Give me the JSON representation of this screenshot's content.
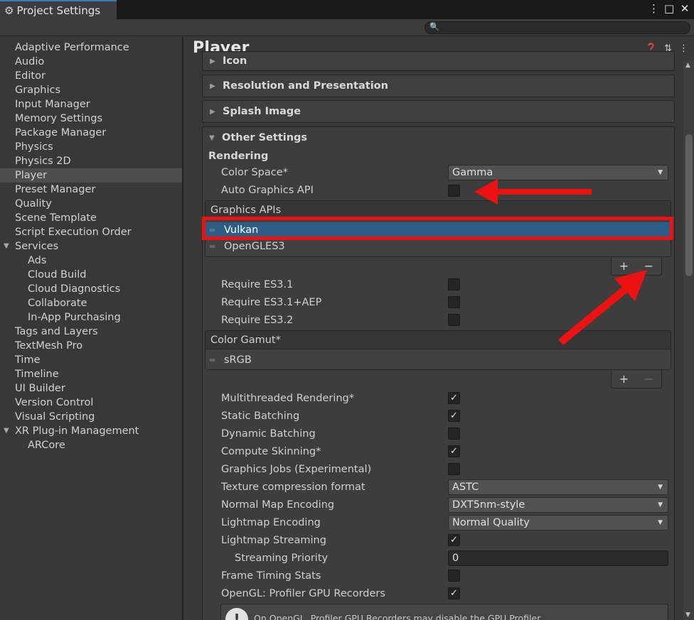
{
  "window": {
    "tab_title": "Project Settings",
    "controls": [
      "⋮",
      "□",
      "✕"
    ]
  },
  "search": {
    "placeholder": "",
    "icon": "search-icon"
  },
  "sidebar": {
    "items": [
      {
        "label": "Adaptive Performance",
        "indent": 0
      },
      {
        "label": "Audio",
        "indent": 0
      },
      {
        "label": "Editor",
        "indent": 0
      },
      {
        "label": "Graphics",
        "indent": 0
      },
      {
        "label": "Input Manager",
        "indent": 0
      },
      {
        "label": "Memory Settings",
        "indent": 0
      },
      {
        "label": "Package Manager",
        "indent": 0
      },
      {
        "label": "Physics",
        "indent": 0
      },
      {
        "label": "Physics 2D",
        "indent": 0
      },
      {
        "label": "Player",
        "indent": 0,
        "selected": true
      },
      {
        "label": "Preset Manager",
        "indent": 0
      },
      {
        "label": "Quality",
        "indent": 0
      },
      {
        "label": "Scene Template",
        "indent": 0
      },
      {
        "label": "Script Execution Order",
        "indent": 0
      },
      {
        "label": "Services",
        "indent": 0,
        "expanded": true
      },
      {
        "label": "Ads",
        "indent": 1
      },
      {
        "label": "Cloud Build",
        "indent": 1
      },
      {
        "label": "Cloud Diagnostics",
        "indent": 1
      },
      {
        "label": "Collaborate",
        "indent": 1
      },
      {
        "label": "In-App Purchasing",
        "indent": 1
      },
      {
        "label": "Tags and Layers",
        "indent": 0
      },
      {
        "label": "TextMesh Pro",
        "indent": 0
      },
      {
        "label": "Time",
        "indent": 0
      },
      {
        "label": "Timeline",
        "indent": 0
      },
      {
        "label": "UI Builder",
        "indent": 0
      },
      {
        "label": "Version Control",
        "indent": 0
      },
      {
        "label": "Visual Scripting",
        "indent": 0
      },
      {
        "label": "XR Plug-in Management",
        "indent": 0,
        "expanded": true
      },
      {
        "label": "ARCore",
        "indent": 1
      }
    ]
  },
  "main": {
    "title": "Player",
    "sections": {
      "icon": "Icon",
      "resolution": "Resolution and Presentation",
      "splash": "Splash Image",
      "other": "Other Settings"
    },
    "rendering": {
      "group_label": "Rendering",
      "color_space_label": "Color Space*",
      "color_space_value": "Gamma",
      "auto_graphics_label": "Auto Graphics API",
      "auto_graphics_checked": false,
      "graphics_apis": {
        "header": "Graphics APIs",
        "items": [
          "Vulkan",
          "OpenGLES3"
        ],
        "selected": "Vulkan"
      },
      "require_es31_label": "Require ES3.1",
      "require_es31_aep_label": "Require ES3.1+AEP",
      "require_es32_label": "Require ES3.2",
      "color_gamut": {
        "header": "Color Gamut*",
        "items": [
          "sRGB"
        ]
      },
      "multithreaded_label": "Multithreaded Rendering*",
      "static_batching_label": "Static Batching",
      "dynamic_batching_label": "Dynamic Batching",
      "compute_skinning_label": "Compute Skinning*",
      "graphics_jobs_label": "Graphics Jobs (Experimental)",
      "texture_compression_label": "Texture compression format",
      "texture_compression_value": "ASTC",
      "normal_map_label": "Normal Map Encoding",
      "normal_map_value": "DXT5nm-style",
      "lightmap_encoding_label": "Lightmap Encoding",
      "lightmap_encoding_value": "Normal Quality",
      "lightmap_streaming_label": "Lightmap Streaming",
      "streaming_priority_label": "Streaming Priority",
      "streaming_priority_value": "0",
      "frame_timing_label": "Frame Timing Stats",
      "opengl_profiler_label": "OpenGL: Profiler GPU Recorders",
      "help_text": "On OpenGL, Profiler GPU Recorders may disable the GPU Profiler"
    },
    "checkmark": "✓",
    "plus": "+",
    "minus": "−"
  },
  "colors": {
    "selection_blue": "#2c5d87",
    "annotation_red": "#ee1111",
    "background": "#383838"
  }
}
